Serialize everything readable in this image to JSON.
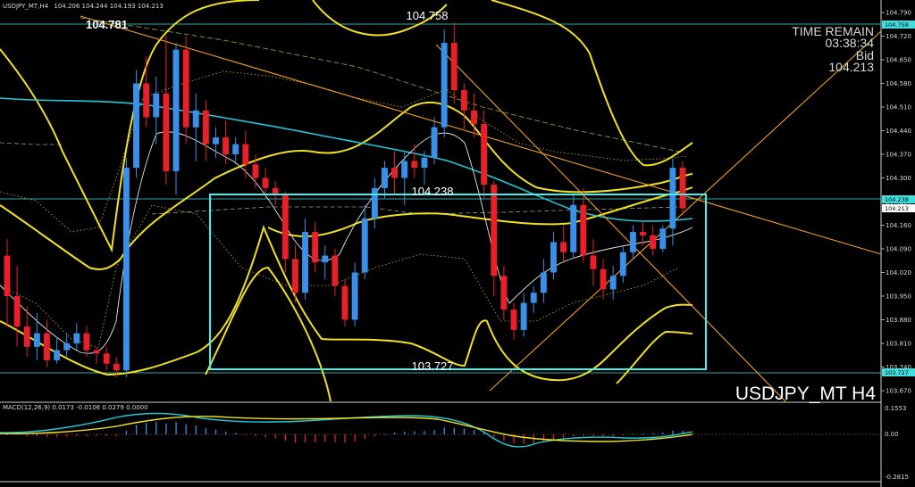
{
  "header": {
    "symbol_line": "USDJPY_MT,H4",
    "ohlc": "104.206 104.244 104.193 104.213"
  },
  "info_panel": {
    "time_remain_label": "TIME REMAIN",
    "time_remain": "03:38:34",
    "bid_label": "Bid",
    "bid": "104.213"
  },
  "symbol_title": "USDJPY_MT H4",
  "levels": {
    "top_label": "104.781",
    "high_label": "104.758",
    "mid_label": "104.238",
    "low_label": "103.727"
  },
  "price_axis": {
    "ticks": [
      "104.790",
      "104.720",
      "104.650",
      "104.580",
      "104.510",
      "104.440",
      "104.370",
      "104.300",
      "104.230",
      "104.160",
      "104.090",
      "104.020",
      "103.950",
      "103.880",
      "103.810",
      "103.740",
      "103.670"
    ],
    "badge_high": "104.758",
    "badge_mid": "104.238",
    "badge_bid": "104.213",
    "badge_low": "103.727"
  },
  "macd_panel": {
    "label": "MACD(12,26,9) 0.0173 -0.0106 0.0279 0.0000",
    "ticks": [
      "0.1553",
      "0.00",
      "-0.2815"
    ]
  },
  "colors": {
    "background": "#000000",
    "bull": "#3a8fe8",
    "bear": "#e8202a",
    "bands": "#f0e020",
    "ma_cyan": "#20c8d8",
    "trend": "#f0a020",
    "box": "#40f0f0"
  },
  "chart_data": {
    "type": "candlestick",
    "symbol": "USDJPY_MT",
    "timeframe": "H4",
    "ylim": [
      103.64,
      104.84
    ],
    "candles": [
      [
        104.07,
        104.12,
        103.86,
        103.95
      ],
      [
        103.95,
        104.04,
        103.8,
        103.86
      ],
      [
        103.86,
        103.92,
        103.77,
        103.8
      ],
      [
        103.8,
        103.9,
        103.76,
        103.84
      ],
      [
        103.84,
        103.88,
        103.74,
        103.76
      ],
      [
        103.76,
        103.83,
        103.75,
        103.79
      ],
      [
        103.79,
        103.84,
        103.77,
        103.81
      ],
      [
        103.81,
        103.87,
        103.79,
        103.84
      ],
      [
        103.84,
        103.86,
        103.77,
        103.79
      ],
      [
        103.79,
        103.8,
        103.75,
        103.78
      ],
      [
        103.78,
        103.8,
        103.73,
        103.75
      ],
      [
        103.75,
        103.77,
        103.71,
        103.73
      ],
      [
        103.73,
        104.36,
        103.71,
        104.33
      ],
      [
        104.33,
        104.62,
        104.3,
        104.58
      ],
      [
        104.58,
        104.66,
        104.45,
        104.48
      ],
      [
        104.48,
        104.6,
        104.4,
        104.55
      ],
      [
        104.55,
        104.72,
        104.28,
        104.32
      ],
      [
        104.32,
        104.7,
        104.25,
        104.68
      ],
      [
        104.68,
        104.72,
        104.4,
        104.45
      ],
      [
        104.45,
        104.55,
        104.35,
        104.5
      ],
      [
        104.5,
        104.53,
        104.35,
        104.4
      ],
      [
        104.4,
        104.45,
        104.36,
        104.42
      ],
      [
        104.42,
        104.47,
        104.34,
        104.37
      ],
      [
        104.37,
        104.42,
        104.34,
        104.4
      ],
      [
        104.4,
        104.44,
        104.3,
        104.34
      ],
      [
        104.34,
        104.37,
        104.27,
        104.3
      ],
      [
        104.3,
        104.33,
        104.24,
        104.27
      ],
      [
        104.27,
        104.29,
        104.22,
        104.25
      ],
      [
        104.25,
        104.26,
        104.02,
        104.06
      ],
      [
        104.06,
        104.1,
        103.93,
        103.96
      ],
      [
        103.96,
        104.18,
        103.94,
        104.14
      ],
      [
        104.14,
        104.17,
        104.02,
        104.05
      ],
      [
        104.05,
        104.1,
        104.0,
        104.07
      ],
      [
        104.07,
        104.09,
        103.95,
        103.98
      ],
      [
        103.98,
        104.0,
        103.86,
        103.88
      ],
      [
        103.88,
        104.05,
        103.86,
        104.02
      ],
      [
        104.02,
        104.22,
        104.0,
        104.18
      ],
      [
        104.18,
        104.3,
        104.15,
        104.27
      ],
      [
        104.27,
        104.35,
        104.24,
        104.33
      ],
      [
        104.33,
        104.38,
        104.25,
        104.3
      ],
      [
        104.3,
        104.38,
        104.22,
        104.35
      ],
      [
        104.35,
        104.4,
        104.3,
        104.33
      ],
      [
        104.33,
        104.38,
        104.28,
        104.36
      ],
      [
        104.36,
        104.48,
        104.34,
        104.45
      ],
      [
        104.45,
        104.74,
        104.42,
        104.7
      ],
      [
        104.7,
        104.76,
        104.52,
        104.56
      ],
      [
        104.56,
        104.58,
        104.44,
        104.5
      ],
      [
        104.5,
        104.55,
        104.42,
        104.46
      ],
      [
        104.46,
        104.5,
        104.24,
        104.28
      ],
      [
        104.28,
        104.29,
        103.95,
        104.01
      ],
      [
        104.01,
        104.04,
        103.88,
        103.91
      ],
      [
        103.91,
        103.93,
        103.82,
        103.85
      ],
      [
        103.85,
        103.96,
        103.83,
        103.93
      ],
      [
        103.93,
        103.98,
        103.9,
        103.96
      ],
      [
        103.96,
        104.06,
        103.93,
        104.02
      ],
      [
        104.02,
        104.14,
        104.0,
        104.11
      ],
      [
        104.11,
        104.16,
        104.05,
        104.08
      ],
      [
        104.08,
        104.25,
        104.06,
        104.22
      ],
      [
        104.22,
        104.27,
        104.05,
        104.07
      ],
      [
        104.07,
        104.12,
        103.98,
        104.03
      ],
      [
        104.03,
        104.06,
        103.94,
        103.97
      ],
      [
        103.97,
        104.04,
        103.94,
        104.01
      ],
      [
        104.01,
        104.1,
        103.99,
        104.08
      ],
      [
        104.08,
        104.16,
        104.06,
        104.14
      ],
      [
        104.14,
        104.17,
        104.1,
        104.13
      ],
      [
        104.13,
        104.16,
        104.07,
        104.09
      ],
      [
        104.09,
        104.16,
        104.08,
        104.15
      ],
      [
        104.15,
        104.36,
        104.1,
        104.33
      ],
      [
        104.33,
        104.35,
        104.19,
        104.21
      ]
    ]
  }
}
